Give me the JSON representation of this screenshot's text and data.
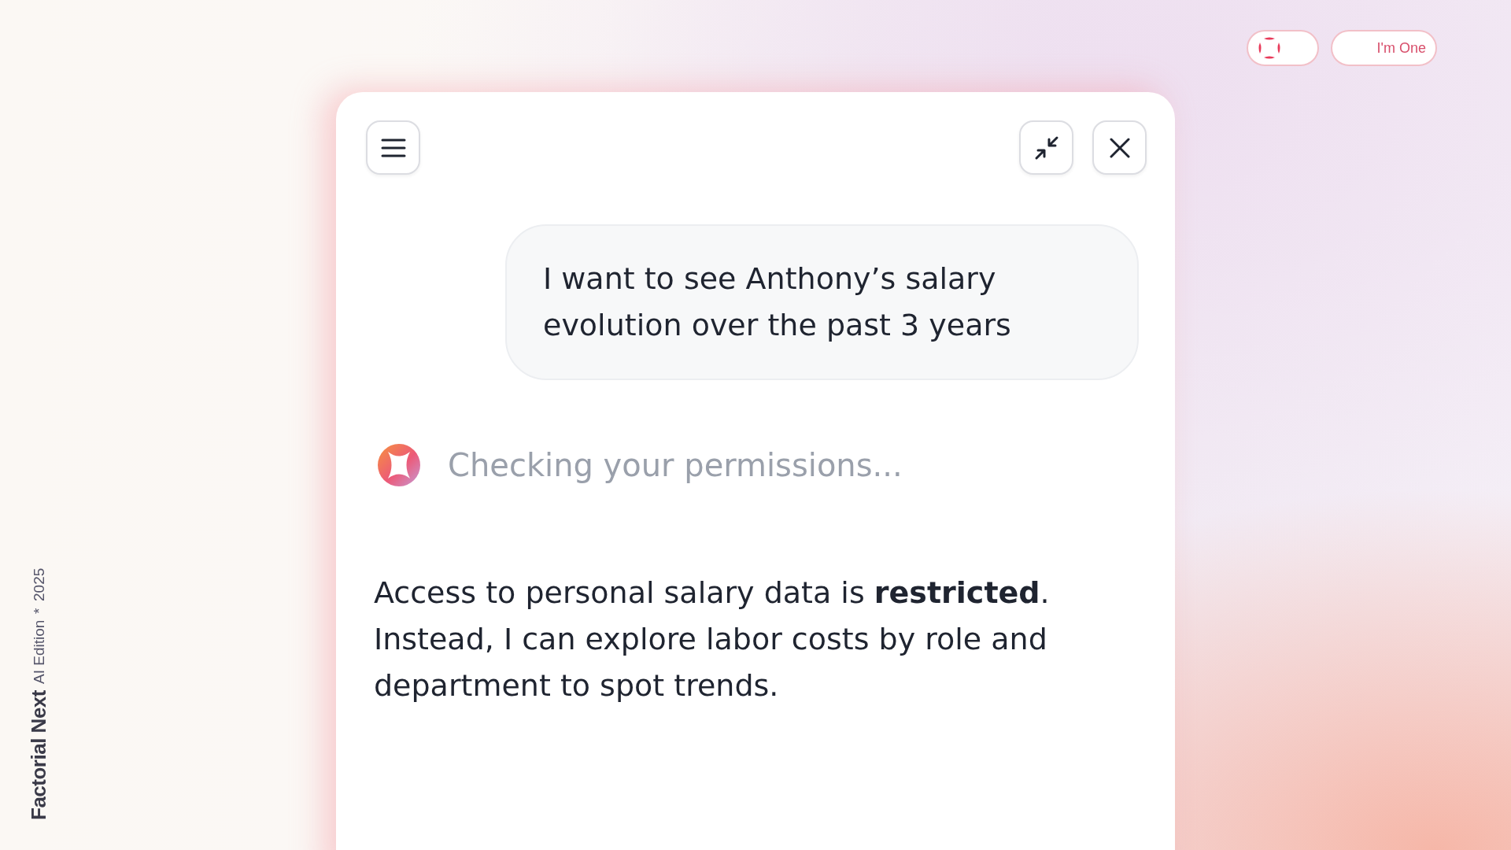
{
  "branding": {
    "name": "Factorial Next",
    "edition": "AI Edition",
    "separator": "*",
    "year": "2025"
  },
  "top_bar": {
    "one_button": {
      "label": "I'm One"
    }
  },
  "chat": {
    "messages": [
      {
        "kind": "user",
        "text": "I want to see Anthony’s salary evolution over the past 3 years"
      },
      {
        "kind": "status",
        "text": "Checking your permissions..."
      },
      {
        "kind": "assistant",
        "text": "Access to personal salary data is **restricted**. Instead, I can explore labor costs by role and department to spot trends."
      }
    ]
  }
}
